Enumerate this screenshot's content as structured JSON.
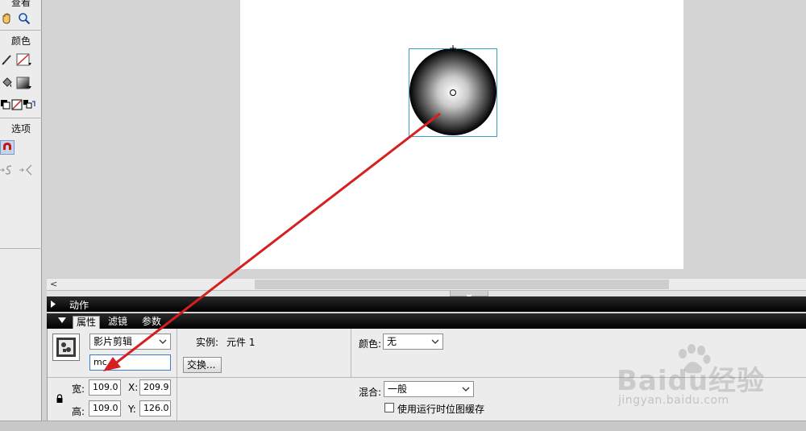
{
  "tools": {
    "view_label": "查看",
    "color_label": "颜色",
    "options_label": "选项"
  },
  "panels": {
    "actions_title": "动作",
    "tabs": [
      {
        "label": "属性",
        "active": true
      },
      {
        "label": "滤镜",
        "active": false
      },
      {
        "label": "参数",
        "active": false
      }
    ]
  },
  "properties": {
    "symbol_type": "影片剪辑",
    "instance_name": "mc",
    "instance_label": "实例:",
    "instance_of": "元件 1",
    "swap_button": "交换...",
    "color_label": "颜色:",
    "color_value": "无",
    "width_label": "宽:",
    "width_value": "109.0",
    "height_label": "高:",
    "height_value": "109.0",
    "x_label": "X:",
    "x_value": "209.9",
    "y_label": "Y:",
    "y_value": "126.0",
    "blend_label": "混合:",
    "blend_value": "一般",
    "cache_label": "使用运行时位图缓存",
    "cache_checked": false
  },
  "watermark": {
    "text": "Baidu经验",
    "url": "jingyan.baidu.com"
  },
  "colors": {
    "annotation_arrow": "#d42020",
    "selection_box": "#3aa0c8",
    "panel_header": "#000000"
  }
}
